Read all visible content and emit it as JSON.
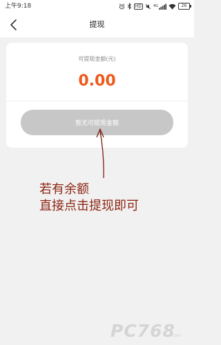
{
  "status_bar": {
    "time": "上午9:18",
    "network": "4G",
    "hd": "HD",
    "battery": "26"
  },
  "header": {
    "title": "提现"
  },
  "card": {
    "balance_label": "可提现金额(元)",
    "balance_value": "0.00",
    "button_label": "暂无可提现金额"
  },
  "annotation": {
    "line1": "若有余额",
    "line2": "直接点击提现即可"
  },
  "watermark": {
    "text": "PC768",
    "subtext": ".com"
  },
  "colors": {
    "accent": "#ed5a1d",
    "annotation": "#8b2413",
    "disabled_button": "#c7c7c7"
  },
  "icons": [
    "back-icon",
    "alarm-icon",
    "bluetooth-icon",
    "mute-icon",
    "signal-icon",
    "wifi-icon",
    "battery-icon"
  ]
}
